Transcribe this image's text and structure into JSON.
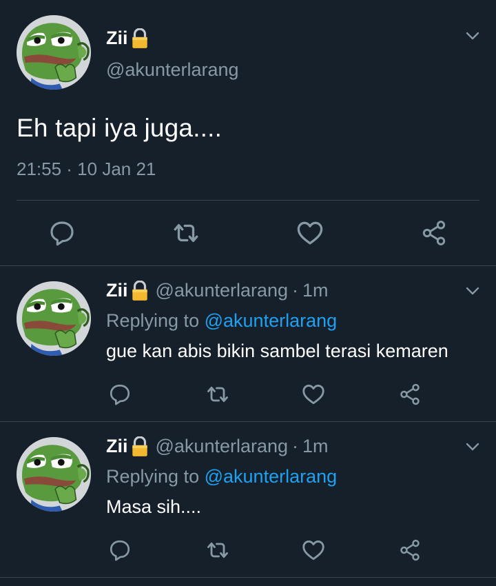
{
  "main_tweet": {
    "name": "Zii",
    "handle": "@akunterlarang",
    "text": "Eh tapi iya juga....",
    "timestamp": "21:55 · 10 Jan 21",
    "avatar": "pepe-frog-avatar"
  },
  "replies": [
    {
      "name": "Zii",
      "handle": "@akunterlarang",
      "separator": "·",
      "time": "1m",
      "replying_prefix": "Replying to",
      "replying_to": "@akunterlarang",
      "text": "gue kan abis bikin sambel terasi kemaren"
    },
    {
      "name": "Zii",
      "handle": "@akunterlarang",
      "separator": "·",
      "time": "1m",
      "replying_prefix": "Replying to",
      "replying_to": "@akunterlarang",
      "text": "Masa sih...."
    }
  ],
  "icons": [
    "lock-icon",
    "chevron-down-icon",
    "reply-icon",
    "retweet-icon",
    "like-icon",
    "share-icon"
  ],
  "colors": {
    "background": "#15202b",
    "secondary_text": "#8899a6",
    "link": "#1da1f2",
    "divider": "#38444d"
  }
}
